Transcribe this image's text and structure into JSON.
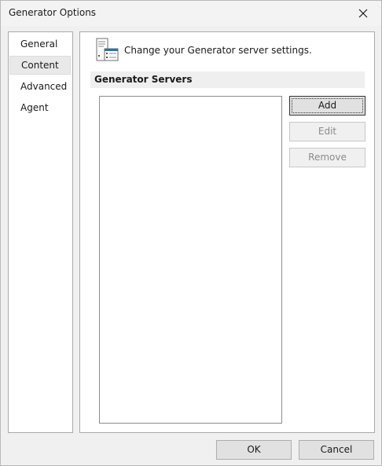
{
  "window": {
    "title": "Generator Options"
  },
  "sidebar": {
    "items": [
      {
        "label": "General",
        "selected": false
      },
      {
        "label": "Content",
        "selected": true
      },
      {
        "label": "Advanced",
        "selected": false
      },
      {
        "label": "Agent",
        "selected": false
      }
    ]
  },
  "content": {
    "header_text": "Change your Generator server settings.",
    "header_icon": "settings-page-icon",
    "section_title": "Generator Servers",
    "server_list": [],
    "buttons": {
      "add": "Add",
      "edit": "Edit",
      "remove": "Remove"
    }
  },
  "footer": {
    "ok": "OK",
    "cancel": "Cancel"
  },
  "colors": {
    "window_background": "#f0f0f0",
    "panel_background": "#ffffff",
    "section_bar": "#efefef",
    "disabled_text": "#8a8a8a"
  }
}
